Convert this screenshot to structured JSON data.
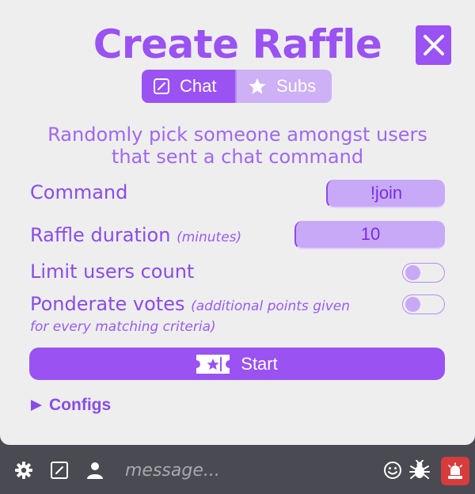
{
  "header": {
    "title": "Create Raffle",
    "close_icon": "close-icon"
  },
  "tabs": [
    {
      "label": "Chat",
      "icon": "edit-square-icon",
      "active": true
    },
    {
      "label": "Subs",
      "icon": "star-icon",
      "active": false
    }
  ],
  "description": {
    "line1": "Randomly pick someone amongst users",
    "line2": "that sent a chat command"
  },
  "form": {
    "command": {
      "label": "Command",
      "value": "!join"
    },
    "duration": {
      "label": "Raffle duration",
      "hint": "(minutes)",
      "value": "10"
    },
    "limit_users": {
      "label": "Limit users count",
      "enabled": false
    },
    "ponderate": {
      "label": "Ponderate votes",
      "hint": "(additional points given",
      "hint2": "for every matching criteria)",
      "enabled": false
    }
  },
  "start_button": {
    "label": "Start",
    "icon": "ticket-icon"
  },
  "configs": {
    "label": "Configs",
    "icon": "triangle-right-icon"
  },
  "chat_bar": {
    "placeholder": "message...",
    "icons": [
      "gear-icon",
      "edit-square-icon",
      "user-icon",
      "smiley-icon",
      "bug-icon",
      "alert-light-icon"
    ]
  },
  "colors": {
    "accent": "#9a52f2",
    "accent_light": "#c8a9f7",
    "panel_bg": "#eeeeee",
    "bar_bg": "#4a4b52",
    "alert": "#d63c3c"
  }
}
